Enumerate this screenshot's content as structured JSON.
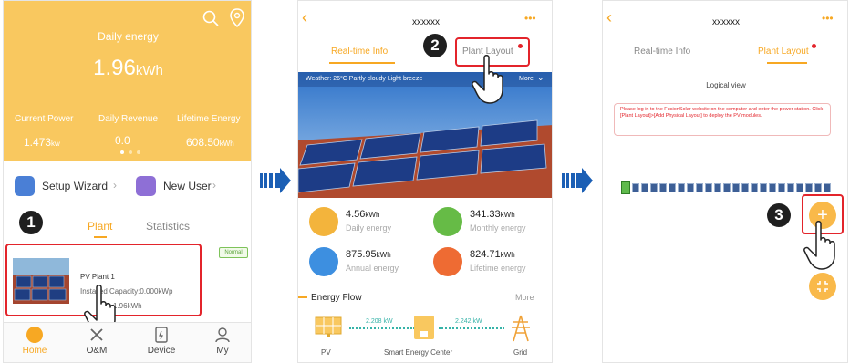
{
  "phone1": {
    "header_title": "Daily energy",
    "energy_value": "1.96",
    "energy_unit": "kWh",
    "stats": [
      {
        "label": "Current Power",
        "value": "1.473",
        "unit": "kw"
      },
      {
        "label": "Daily Revenue",
        "value": "0.0",
        "unit": ""
      },
      {
        "label": "Lifetime Energy",
        "value": "608.50",
        "unit": "kWh"
      }
    ],
    "setup_wizard": "Setup Wizard",
    "new_user": "New User",
    "tab_plant": "Plant",
    "tab_statistics": "Statistics",
    "plant_name": "PV Plant 1",
    "plant_capacity": "Installed Capacity:0.000kWp",
    "plant_energy": "1.96kWh",
    "plant_status": "Normal",
    "step": "1",
    "nav": [
      "Home",
      "O&M",
      "Device",
      "My"
    ]
  },
  "phone2": {
    "title": "xxxxxx",
    "more": "•••",
    "tab_realtime": "Real-time Info",
    "tab_layout": "Plant Layout",
    "weather": "Weather: 26°C  Partly cloudy  Light breeze",
    "weather_more": "More",
    "metrics": [
      {
        "value": "4.56",
        "unit": "kWh",
        "label": "Daily energy",
        "color": "#f3b43c"
      },
      {
        "value": "341.33",
        "unit": "kWh",
        "label": "Monthly energy",
        "color": "#66bb46"
      },
      {
        "value": "875.95",
        "unit": "kWh",
        "label": "Annual energy",
        "color": "#3d8fe0"
      },
      {
        "value": "824.71",
        "unit": "kWh",
        "label": "Lifetime energy",
        "color": "#ee6b33"
      }
    ],
    "energy_flow": "Energy Flow",
    "flow_more": "More",
    "flow_left_kw": "2.208 kW",
    "flow_right_kw": "2.242 kW",
    "flow_labels": [
      "PV",
      "Smart Energy Center",
      "Grid"
    ],
    "step": "2"
  },
  "phone3": {
    "title": "xxxxxx",
    "more": "•••",
    "tab_realtime": "Real-time Info",
    "tab_layout": "Plant Layout",
    "logical_view": "Logical view",
    "notice": "Please log in to the FusionSolar website on the computer and enter the power station. Click [Plant Layout]>[Add Physical Layout] to deploy the PV modules.",
    "step": "3"
  },
  "colors": {
    "accent": "#f7a823",
    "highlight": "#e3242b",
    "header": "#f9c85f",
    "arrow": "#1b5fb5"
  }
}
